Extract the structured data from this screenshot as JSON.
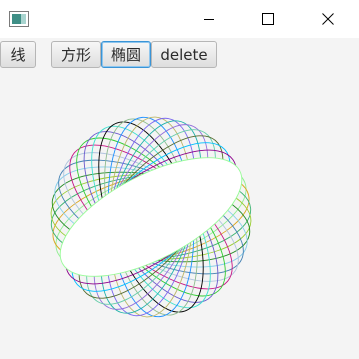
{
  "window": {
    "icon": "java-app-icon",
    "controls": [
      "minimize-icon",
      "maximize-icon",
      "close-icon"
    ]
  },
  "toolbar": {
    "buttons": [
      {
        "label": "线"
      },
      {
        "label": "方形"
      },
      {
        "label": "椭圆",
        "active": true
      },
      {
        "label": "delete"
      }
    ]
  },
  "canvas": {
    "shape": "ellipse",
    "ellipse_count": 24,
    "rotation_step_deg": 7.5,
    "colors": [
      "#90ee90",
      "#daa520",
      "#3cb371",
      "#9acd32",
      "#228b22",
      "#87ceeb",
      "#4682b4",
      "#b0c4de",
      "#c71585",
      "#32cd32",
      "#6a5acd",
      "#40e0d0",
      "#000000",
      "#8fbc8f",
      "#1e90ff",
      "#bdb76b",
      "#7b68ee",
      "#20b2aa",
      "#9370db",
      "#66cdaa",
      "#556b2f",
      "#00bfff",
      "#8b008b",
      "#98fb98"
    ]
  }
}
